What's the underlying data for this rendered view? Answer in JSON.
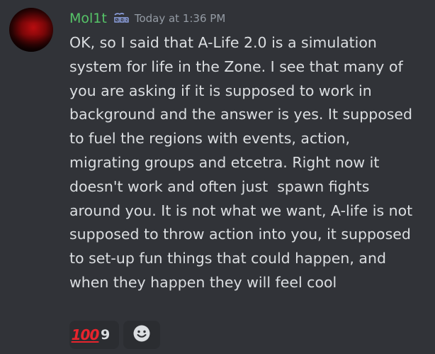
{
  "message": {
    "author": "Mol1t",
    "timestamp": "Today at 1:36 PM",
    "text": "OK, so I said that A-Life 2.0 is a simulation system for life in the Zone. I see that many of you are asking if it is supposed to work in background and the answer is yes. It supposed to fuel the regions with events, action, migrating groups and etcetra. Right now it doesn't work and often just  spawn fights around you. It is not what we want, A-life is not supposed to throw action into you, it supposed to set-up fun things that could happen, and when they happen they will feel cool",
    "author_color": "#56c568",
    "icons": {
      "avatar": "avatar-image",
      "tag": "server-tag-icon"
    }
  },
  "reactions": [
    {
      "emoji": "100",
      "emoji_name": "hundred-points-emoji",
      "count": "9"
    }
  ],
  "add_reaction": {
    "icon": "smiley-icon"
  },
  "colors": {
    "background": "#313338",
    "text": "#dbdee1",
    "muted": "#949ba4",
    "reaction_bg": "#2b2d31",
    "emoji_red": "#e8242d"
  }
}
